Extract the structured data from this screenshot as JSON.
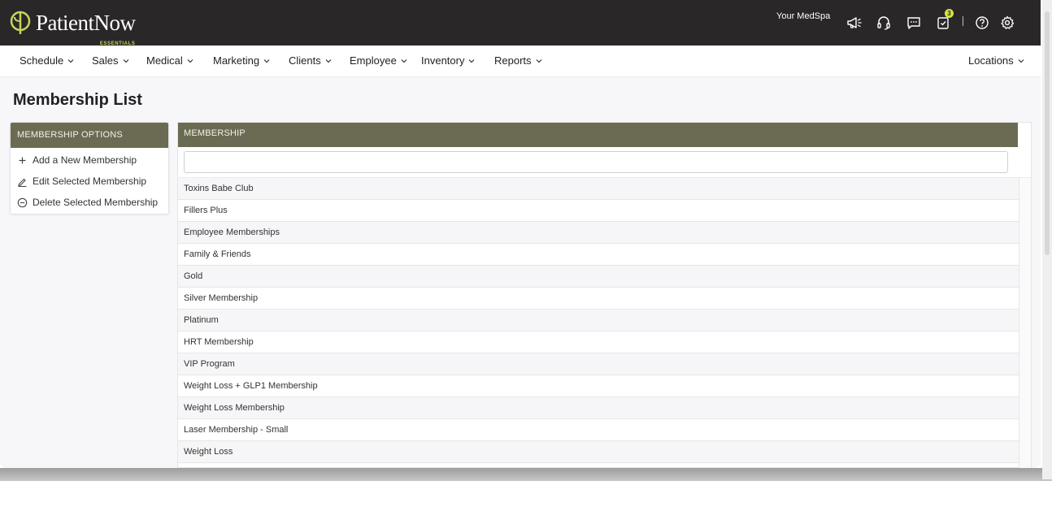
{
  "brand": {
    "name": "PatientNow",
    "sub": "ESSENTIALS"
  },
  "header": {
    "org_name": "Your MedSpa",
    "task_count": "3",
    "accent_color": "#d6e53e"
  },
  "nav": {
    "items": [
      {
        "label": "Schedule"
      },
      {
        "label": "Sales"
      },
      {
        "label": "Medical"
      },
      {
        "label": "Marketing"
      },
      {
        "label": "Clients"
      },
      {
        "label": "Employee"
      },
      {
        "label": "Inventory"
      },
      {
        "label": "Reports"
      }
    ],
    "locations": "Locations"
  },
  "page": {
    "title": "Membership List"
  },
  "options_panel": {
    "header": "MEMBERSHIP OPTIONS",
    "header_color": "#6b6b53",
    "items": [
      {
        "label": "Add a New Membership",
        "icon": "plus-icon"
      },
      {
        "label": "Edit Selected Membership",
        "icon": "pencil-icon"
      },
      {
        "label": "Delete Selected Membership",
        "icon": "minus-circle-icon"
      }
    ]
  },
  "membership_list": {
    "header": "MEMBERSHIP",
    "filter_value": "",
    "rows": [
      "Toxins Babe Club",
      "Fillers Plus",
      "Employee Memberships",
      "Family & Friends",
      "Gold",
      "Silver Membership",
      "Platinum",
      "HRT Membership",
      "VIP Program",
      "Weight Loss + GLP1 Membership",
      "Weight Loss Membership",
      "Laser Membership - Small",
      "Weight Loss"
    ]
  }
}
